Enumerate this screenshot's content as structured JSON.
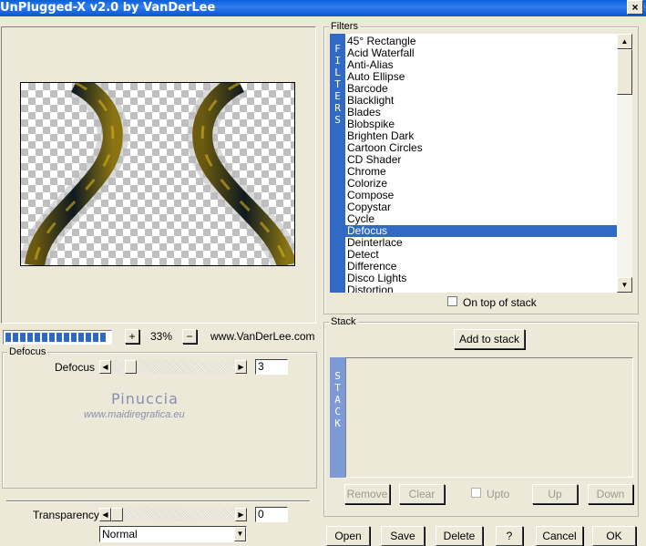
{
  "window": {
    "title": "UnPlugged-X v2.0 by VanDerLee",
    "close_glyph": "×"
  },
  "preview": {
    "zoom_plus": "+",
    "zoom_value": "33%",
    "zoom_minus": "−",
    "website": "www.VanDerLee.com",
    "progress_fraction": 1.0
  },
  "filter_params": {
    "group_label": "Defocus",
    "defocus": {
      "label": "Defocus",
      "value": "3",
      "slider_fraction": 0.12
    },
    "watermark": {
      "name": "Pinuccia",
      "url": "www.maidiregrafica.eu"
    }
  },
  "bottom_left": {
    "transparency": {
      "label": "Transparency",
      "value": "0",
      "slider_fraction": 0.0
    },
    "blend_mode": {
      "selected": "Normal"
    }
  },
  "filters": {
    "group_label": "Filters",
    "side_label": [
      "F",
      "I",
      "L",
      "T",
      "E",
      "R",
      "S"
    ],
    "items": [
      "45° Rectangle",
      "Acid Waterfall",
      "Anti-Alias",
      "Auto Ellipse",
      "Barcode",
      "Blacklight",
      "Blades",
      "Blobspike",
      "Brighten Dark",
      "Cartoon Circles",
      "CD Shader",
      "Chrome",
      "Colorize",
      "Compose",
      "Copystar",
      "Cycle",
      "Defocus",
      "Deinterlace",
      "Detect",
      "Difference",
      "Disco Lights",
      "Distortion"
    ],
    "selected_index": 16,
    "on_top_label": "On top of stack",
    "on_top_checked": false
  },
  "stack": {
    "group_label": "Stack",
    "add_label": "Add to stack",
    "side_label": [
      "S",
      "T",
      "A",
      "C",
      "K"
    ],
    "remove_label": "Remove",
    "clear_label": "Clear",
    "upto_label": "Upto",
    "up_label": "Up",
    "down_label": "Down"
  },
  "footer": {
    "open": "Open",
    "save": "Save",
    "delete": "Delete",
    "help": "?",
    "cancel": "Cancel",
    "ok": "OK"
  },
  "colors": {
    "accent": "#316ac5",
    "titlebar": "#0a5fd8",
    "stack_strip": "#7e9ad6",
    "face": "#ece9d8"
  }
}
